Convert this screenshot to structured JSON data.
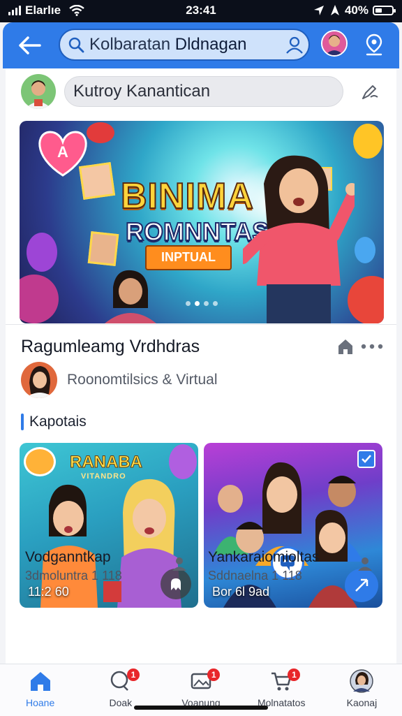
{
  "status_bar": {
    "carrier": "Elarlıe",
    "time": "23:41",
    "battery": "40%",
    "battery_level": 0.4
  },
  "app_bar": {
    "search_text_prefix": "Kolbaratan",
    "search_text_bold": "Dldnagan",
    "icons": {
      "back": "back-arrow-icon",
      "search": "search-icon",
      "user": "user-outline-icon",
      "location": "location-pin-icon"
    }
  },
  "composer": {
    "placeholder": "Kutroy Kanantican",
    "icon": "edit-icon"
  },
  "hero": {
    "title_line1": "BINIMA",
    "title_line2": "ROMNNTAS",
    "ribbon": "INPTUAL",
    "slide_count": 4,
    "active_slide": 1
  },
  "post": {
    "title": "Ragumleamg Vrdhdras",
    "author": "Roonomtilsics & Virtual",
    "icons": {
      "home": "home-icon",
      "more": "more-dots-icon"
    }
  },
  "section": {
    "label": "Kapotais"
  },
  "cards": [
    {
      "image_title": "RANABA",
      "image_subtitle": "VITANDRO",
      "badge": "11:2 60",
      "title": "Vodganntkap",
      "subtitle": "3dmoluntra 1 118",
      "icon": "person-icon"
    },
    {
      "badge": "Bor 6l 9ad",
      "title": "Yankaraiomioltas",
      "subtitle": "Sddnaelna 1 118",
      "icon": "person-icon"
    }
  ],
  "bottom_nav": [
    {
      "label": "Hoane",
      "icon": "home-icon",
      "active": true
    },
    {
      "label": "Doak",
      "icon": "chat-icon",
      "badge": "1"
    },
    {
      "label": "Voanung",
      "icon": "photo-gallery-icon",
      "badge": "1"
    },
    {
      "label": "Molnatatos",
      "icon": "cart-icon",
      "badge": "1"
    },
    {
      "label": "Kaonaj",
      "icon": "profile-avatar-icon"
    }
  ],
  "colors": {
    "accent": "#2f7be8",
    "badge_red": "#e8262a",
    "app_bar": "#2f7be8"
  }
}
